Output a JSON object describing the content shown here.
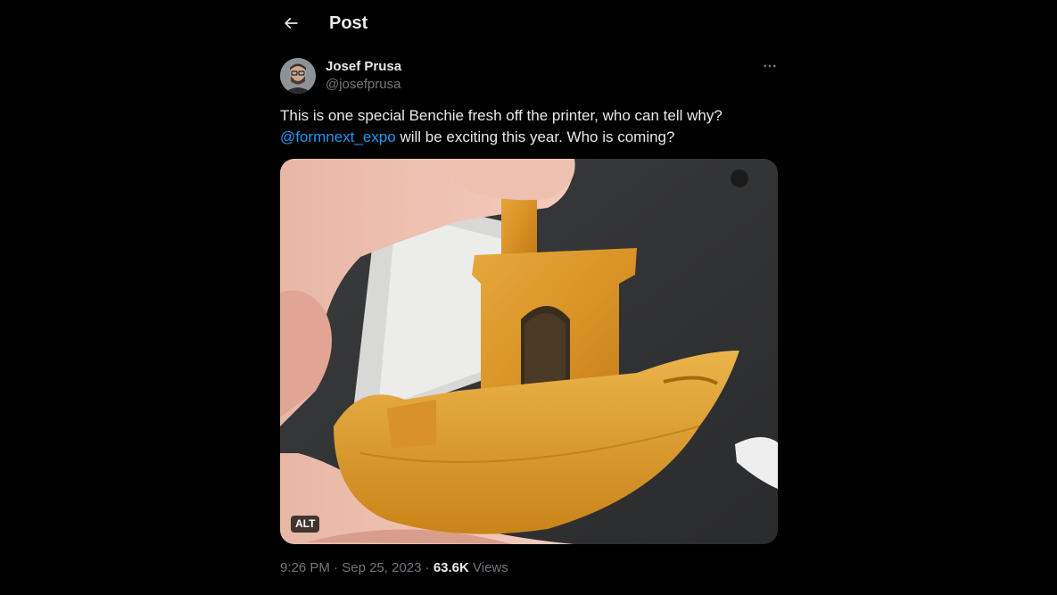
{
  "header": {
    "title": "Post",
    "back_icon": "arrow-left-icon"
  },
  "author": {
    "name": "Josef Prusa",
    "handle": "@josefprusa",
    "avatar_icon": "user-avatar",
    "more_icon": "more-horizontal-icon"
  },
  "tweet": {
    "text_part1": "This is one special Benchie fresh off the printer, who can tell why?",
    "mention": "@formnext_expo",
    "text_part2": " will be exciting this year. Who is coming?"
  },
  "media": {
    "alt_badge": "ALT"
  },
  "meta": {
    "time": "9:26 PM",
    "separator1": " · ",
    "date": "Sep 25, 2023",
    "separator2": " · ",
    "views_count": "63.6K",
    "views_label": " Views"
  },
  "colors": {
    "background": "#000000",
    "text_primary": "#e7e9ea",
    "text_secondary": "#71767b",
    "accent": "#1d9bf0"
  }
}
